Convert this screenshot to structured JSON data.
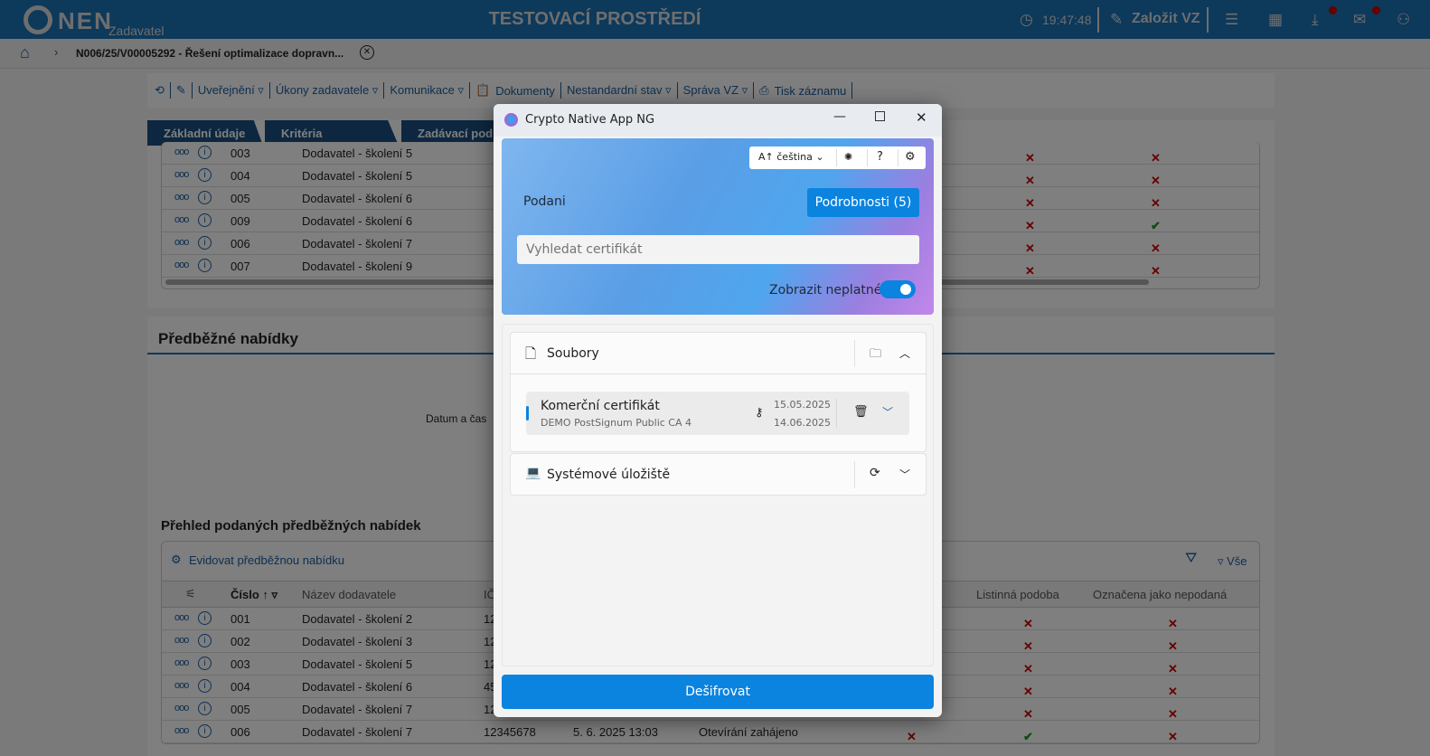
{
  "header": {
    "logo": "NEN",
    "subtitle": "Zadavatel",
    "environment": "TESTOVACÍ PROSTŘEDÍ",
    "time": "19:47:48",
    "create_label": "Založit VZ"
  },
  "breadcrumb": {
    "title": "N006/25/V00005292 - Řešení optimalizace dopravn..."
  },
  "toolbar": {
    "items": [
      "Uveřejnění ▿",
      "Úkony zadavatele ▿",
      "Komunikace ▿",
      "Dokumenty",
      "Nestandardní stav ▿",
      "Správa VZ ▿",
      "Tisk záznamu"
    ]
  },
  "tabs": [
    "Základní údaje",
    "Kritéria hodnocení",
    "Zadávací pod"
  ],
  "upper_table": {
    "rows": [
      {
        "num": "003",
        "name": "Dodavatel - školení 5",
        "c1": "x",
        "c2": "x"
      },
      {
        "num": "004",
        "name": "Dodavatel - školení 5",
        "c1": "x",
        "c2": "x"
      },
      {
        "num": "005",
        "name": "Dodavatel - školení 6",
        "c1": "x",
        "c2": "x"
      },
      {
        "num": "009",
        "name": "Dodavatel - školení 6",
        "c1": "x",
        "c2": "ok"
      },
      {
        "num": "006",
        "name": "Dodavatel - školení 7",
        "c1": "x",
        "c2": "x"
      },
      {
        "num": "007",
        "name": "Dodavatel - školení 9",
        "c1": "x",
        "c2": "x"
      }
    ]
  },
  "section": {
    "title": "Předběžné nabídky",
    "datetime_label": "Datum a čas",
    "overview_title": "Přehled podaných předběžných nabídek",
    "add_label": "Evidovat předběžnou nabídku",
    "filter_all": "Vše"
  },
  "lower_table": {
    "columns": [
      "Číslo",
      "Název dodavatele",
      "IČ",
      "Listinná podoba",
      "Označena jako nepodaná"
    ],
    "rows": [
      {
        "num": "001",
        "name": "Dodavatel - školení 2",
        "ic": "12",
        "paper": "x",
        "unsub": "x"
      },
      {
        "num": "002",
        "name": "Dodavatel - školení 3",
        "ic": "12",
        "paper": "x",
        "unsub": "x"
      },
      {
        "num": "003",
        "name": "Dodavatel - školení 5",
        "ic": "12",
        "paper": "x",
        "unsub": "x"
      },
      {
        "num": "004",
        "name": "Dodavatel - školení 6",
        "ic": "45",
        "paper": "x",
        "unsub": "x"
      },
      {
        "num": "005",
        "name": "Dodavatel - školení 7",
        "ic": "12",
        "paper": "x",
        "unsub": "x"
      },
      {
        "num": "006",
        "name": "Dodavatel - školení 7",
        "ic": "12345678",
        "date": "5. 6. 2025 13:03",
        "state": "Otevírání zahájeno",
        "extra": "x",
        "paper": "ok",
        "unsub": "x"
      }
    ]
  },
  "modal": {
    "title": "Crypto Native App NG",
    "language": "čeština",
    "signer": "Podani",
    "details_button": "Podrobnosti (5)",
    "search_placeholder": "Vyhledat certifikát",
    "show_invalid_label": "Zobrazit neplatné",
    "show_invalid": true,
    "files_section": "Soubory",
    "cert": {
      "name": "Komerční certifikát",
      "issuer": "DEMO PostSignum Public CA 4",
      "valid_from": "15.05.2025",
      "valid_to": "14.06.2025"
    },
    "system_section": "Systémové úložiště",
    "decrypt_button": "Dešifrovat"
  },
  "colors": {
    "header": "#1b73b6",
    "accent": "#0b84e0",
    "error": "#c00000",
    "success": "#1a9a1a"
  }
}
